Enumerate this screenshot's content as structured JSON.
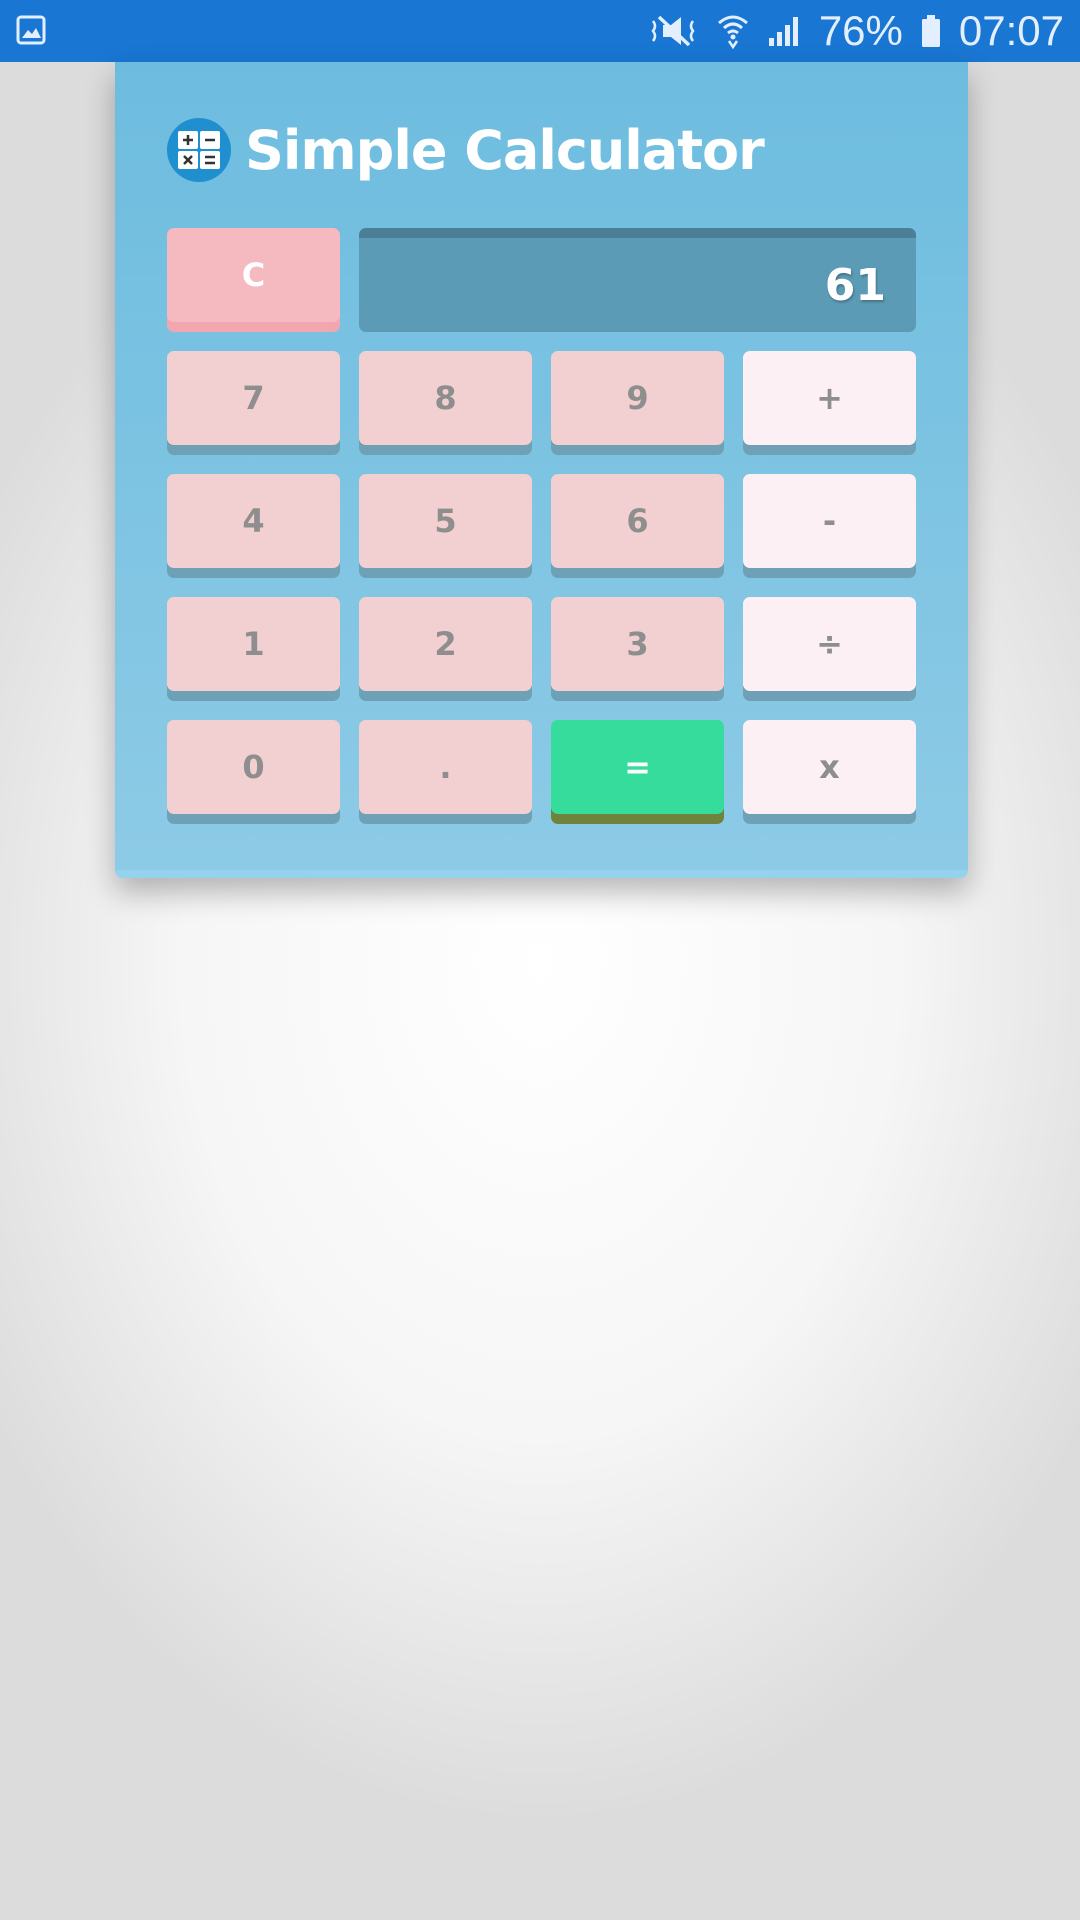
{
  "status_bar": {
    "battery_percent": "76%",
    "time": "07:07",
    "icons": [
      "image-icon",
      "mute-icon",
      "wifi-icon",
      "signal-icon",
      "battery-icon"
    ]
  },
  "app": {
    "title": "Simple Calculator",
    "icon": "calculator-icon"
  },
  "display": {
    "value": "61"
  },
  "buttons": {
    "clear": "C",
    "seven": "7",
    "eight": "8",
    "nine": "9",
    "plus": "+",
    "four": "4",
    "five": "5",
    "six": "6",
    "minus": "-",
    "one": "1",
    "two": "2",
    "three": "3",
    "divide": "÷",
    "zero": "0",
    "dot": ".",
    "equals": "=",
    "multiply": "x"
  },
  "colors": {
    "status_bar": "#1976d2",
    "card": "#6dbcdf",
    "number_button": "#f2d0d1",
    "operator_button": "#fdf0f4",
    "equals_button": "#35dc9c",
    "clear_button": "#f5b9c0",
    "display": "#5c9bb5"
  }
}
